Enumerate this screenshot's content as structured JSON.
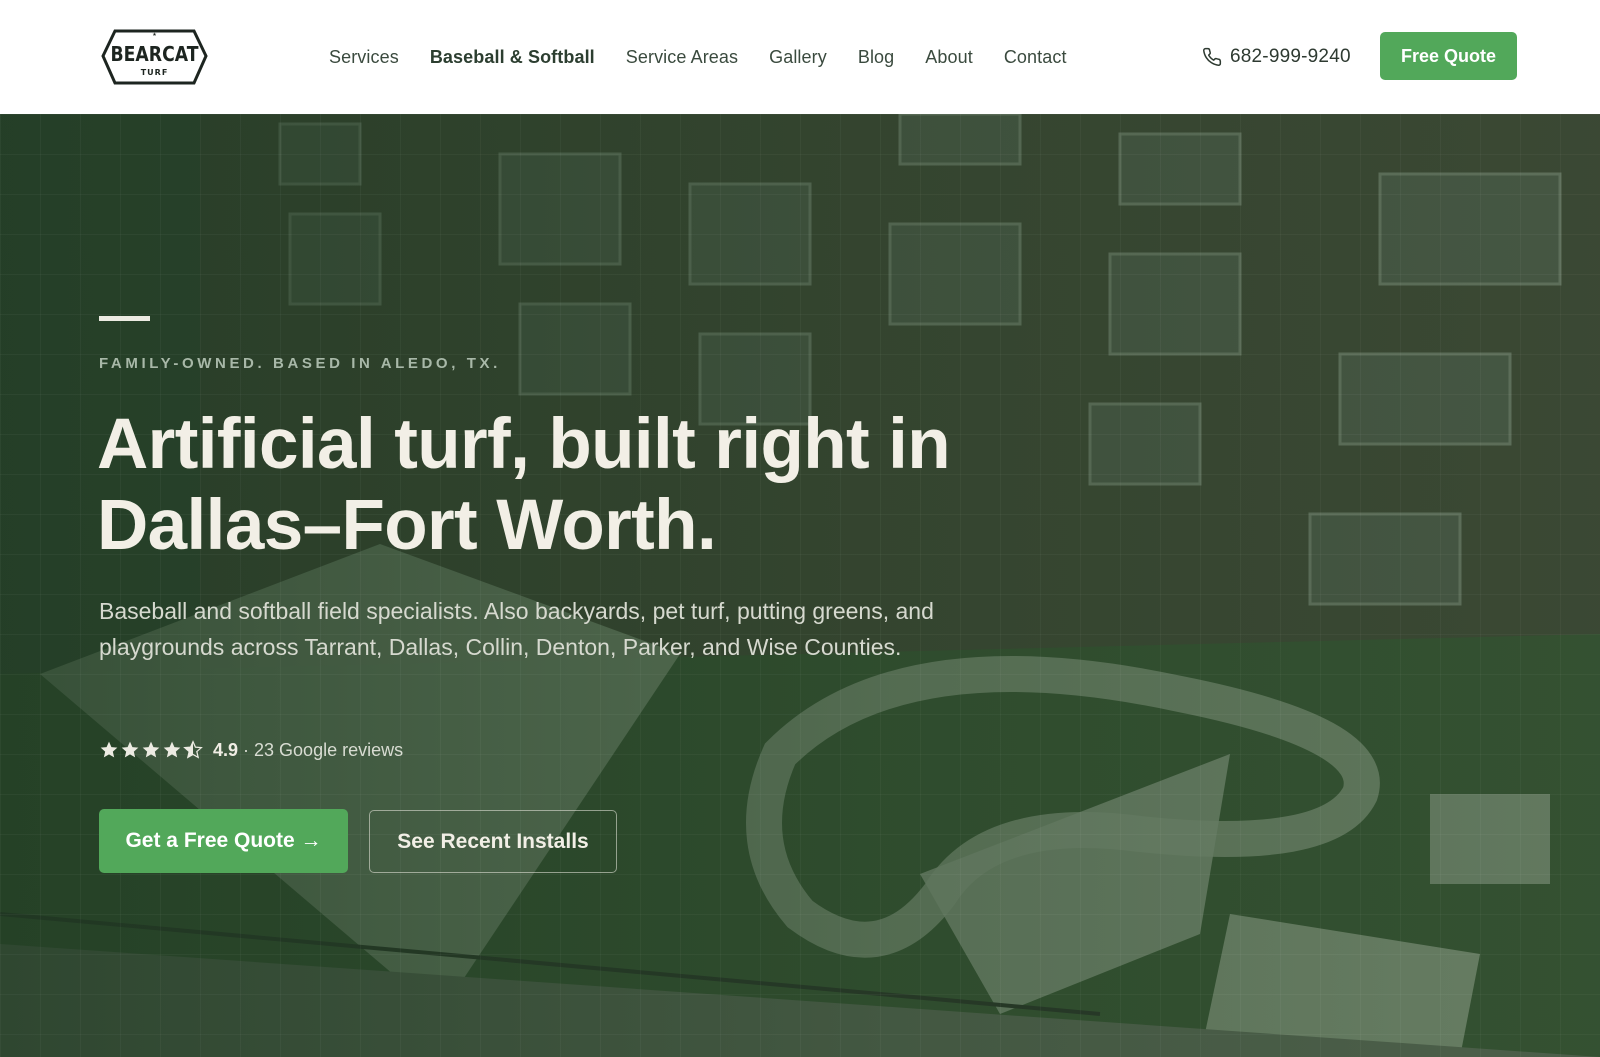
{
  "brand": {
    "logo_text": "BEARCAT",
    "logo_subtext": "TURF"
  },
  "nav": {
    "items": [
      {
        "label": "Services",
        "active": false
      },
      {
        "label": "Baseball & Softball",
        "active": true
      },
      {
        "label": "Service Areas",
        "active": false
      },
      {
        "label": "Gallery",
        "active": false
      },
      {
        "label": "Blog",
        "active": false
      },
      {
        "label": "About",
        "active": false
      },
      {
        "label": "Contact",
        "active": false
      }
    ]
  },
  "header": {
    "phone": "682-999-9240",
    "phone_icon": "phone-icon",
    "cta_label": "Free Quote"
  },
  "hero": {
    "eyebrow": "FAMILY-OWNED. BASED IN ALEDO, TX.",
    "headline": "Artificial turf, built right in Dallas–Fort Worth.",
    "subcopy": "Baseball and softball field specialists. Also backyards, pet turf, putting greens, and playgrounds across Tarrant, Dallas, Collin, Denton, Parker, and Wise Counties.",
    "rating": {
      "stars": 4.5,
      "score": "4.9",
      "reviews_text": "· 23 Google reviews"
    },
    "primary_cta": "Get a Free Quote →",
    "secondary_cta": "See Recent Installs"
  },
  "colors": {
    "accent_green": "#52a85a",
    "hero_overlay": "#1e3a22",
    "headline_text": "#f2efe6"
  }
}
